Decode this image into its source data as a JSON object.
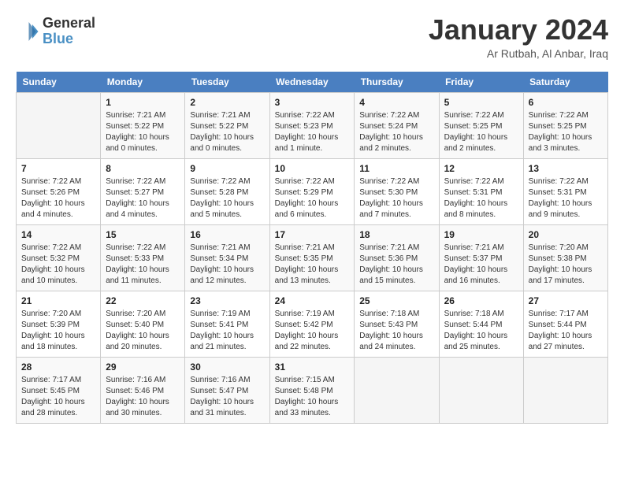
{
  "header": {
    "logo_line1": "General",
    "logo_line2": "Blue",
    "month": "January 2024",
    "location": "Ar Rutbah, Al Anbar, Iraq"
  },
  "days_of_week": [
    "Sunday",
    "Monday",
    "Tuesday",
    "Wednesday",
    "Thursday",
    "Friday",
    "Saturday"
  ],
  "weeks": [
    [
      {
        "day": "",
        "info": ""
      },
      {
        "day": "1",
        "info": "Sunrise: 7:21 AM\nSunset: 5:22 PM\nDaylight: 10 hours\nand 0 minutes."
      },
      {
        "day": "2",
        "info": "Sunrise: 7:21 AM\nSunset: 5:22 PM\nDaylight: 10 hours\nand 0 minutes."
      },
      {
        "day": "3",
        "info": "Sunrise: 7:22 AM\nSunset: 5:23 PM\nDaylight: 10 hours\nand 1 minute."
      },
      {
        "day": "4",
        "info": "Sunrise: 7:22 AM\nSunset: 5:24 PM\nDaylight: 10 hours\nand 2 minutes."
      },
      {
        "day": "5",
        "info": "Sunrise: 7:22 AM\nSunset: 5:25 PM\nDaylight: 10 hours\nand 2 minutes."
      },
      {
        "day": "6",
        "info": "Sunrise: 7:22 AM\nSunset: 5:25 PM\nDaylight: 10 hours\nand 3 minutes."
      }
    ],
    [
      {
        "day": "7",
        "info": "Sunrise: 7:22 AM\nSunset: 5:26 PM\nDaylight: 10 hours\nand 4 minutes."
      },
      {
        "day": "8",
        "info": "Sunrise: 7:22 AM\nSunset: 5:27 PM\nDaylight: 10 hours\nand 4 minutes."
      },
      {
        "day": "9",
        "info": "Sunrise: 7:22 AM\nSunset: 5:28 PM\nDaylight: 10 hours\nand 5 minutes."
      },
      {
        "day": "10",
        "info": "Sunrise: 7:22 AM\nSunset: 5:29 PM\nDaylight: 10 hours\nand 6 minutes."
      },
      {
        "day": "11",
        "info": "Sunrise: 7:22 AM\nSunset: 5:30 PM\nDaylight: 10 hours\nand 7 minutes."
      },
      {
        "day": "12",
        "info": "Sunrise: 7:22 AM\nSunset: 5:31 PM\nDaylight: 10 hours\nand 8 minutes."
      },
      {
        "day": "13",
        "info": "Sunrise: 7:22 AM\nSunset: 5:31 PM\nDaylight: 10 hours\nand 9 minutes."
      }
    ],
    [
      {
        "day": "14",
        "info": "Sunrise: 7:22 AM\nSunset: 5:32 PM\nDaylight: 10 hours\nand 10 minutes."
      },
      {
        "day": "15",
        "info": "Sunrise: 7:22 AM\nSunset: 5:33 PM\nDaylight: 10 hours\nand 11 minutes."
      },
      {
        "day": "16",
        "info": "Sunrise: 7:21 AM\nSunset: 5:34 PM\nDaylight: 10 hours\nand 12 minutes."
      },
      {
        "day": "17",
        "info": "Sunrise: 7:21 AM\nSunset: 5:35 PM\nDaylight: 10 hours\nand 13 minutes."
      },
      {
        "day": "18",
        "info": "Sunrise: 7:21 AM\nSunset: 5:36 PM\nDaylight: 10 hours\nand 15 minutes."
      },
      {
        "day": "19",
        "info": "Sunrise: 7:21 AM\nSunset: 5:37 PM\nDaylight: 10 hours\nand 16 minutes."
      },
      {
        "day": "20",
        "info": "Sunrise: 7:20 AM\nSunset: 5:38 PM\nDaylight: 10 hours\nand 17 minutes."
      }
    ],
    [
      {
        "day": "21",
        "info": "Sunrise: 7:20 AM\nSunset: 5:39 PM\nDaylight: 10 hours\nand 18 minutes."
      },
      {
        "day": "22",
        "info": "Sunrise: 7:20 AM\nSunset: 5:40 PM\nDaylight: 10 hours\nand 20 minutes."
      },
      {
        "day": "23",
        "info": "Sunrise: 7:19 AM\nSunset: 5:41 PM\nDaylight: 10 hours\nand 21 minutes."
      },
      {
        "day": "24",
        "info": "Sunrise: 7:19 AM\nSunset: 5:42 PM\nDaylight: 10 hours\nand 22 minutes."
      },
      {
        "day": "25",
        "info": "Sunrise: 7:18 AM\nSunset: 5:43 PM\nDaylight: 10 hours\nand 24 minutes."
      },
      {
        "day": "26",
        "info": "Sunrise: 7:18 AM\nSunset: 5:44 PM\nDaylight: 10 hours\nand 25 minutes."
      },
      {
        "day": "27",
        "info": "Sunrise: 7:17 AM\nSunset: 5:44 PM\nDaylight: 10 hours\nand 27 minutes."
      }
    ],
    [
      {
        "day": "28",
        "info": "Sunrise: 7:17 AM\nSunset: 5:45 PM\nDaylight: 10 hours\nand 28 minutes."
      },
      {
        "day": "29",
        "info": "Sunrise: 7:16 AM\nSunset: 5:46 PM\nDaylight: 10 hours\nand 30 minutes."
      },
      {
        "day": "30",
        "info": "Sunrise: 7:16 AM\nSunset: 5:47 PM\nDaylight: 10 hours\nand 31 minutes."
      },
      {
        "day": "31",
        "info": "Sunrise: 7:15 AM\nSunset: 5:48 PM\nDaylight: 10 hours\nand 33 minutes."
      },
      {
        "day": "",
        "info": ""
      },
      {
        "day": "",
        "info": ""
      },
      {
        "day": "",
        "info": ""
      }
    ]
  ]
}
